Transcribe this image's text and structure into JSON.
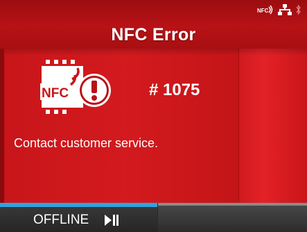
{
  "header": {
    "title": "NFC Error",
    "status_icons": [
      "nfc-status-icon",
      "network-icon",
      "bluetooth-icon"
    ]
  },
  "error": {
    "icon_label": "NFC",
    "code": "# 1075",
    "message": "Contact customer service."
  },
  "footer": {
    "status_label": "OFFLINE",
    "toggle_icon": "play-pause-icon"
  },
  "colors": {
    "background": "#b30f12",
    "accent": "#2ea4e0",
    "text": "#ffffff"
  }
}
